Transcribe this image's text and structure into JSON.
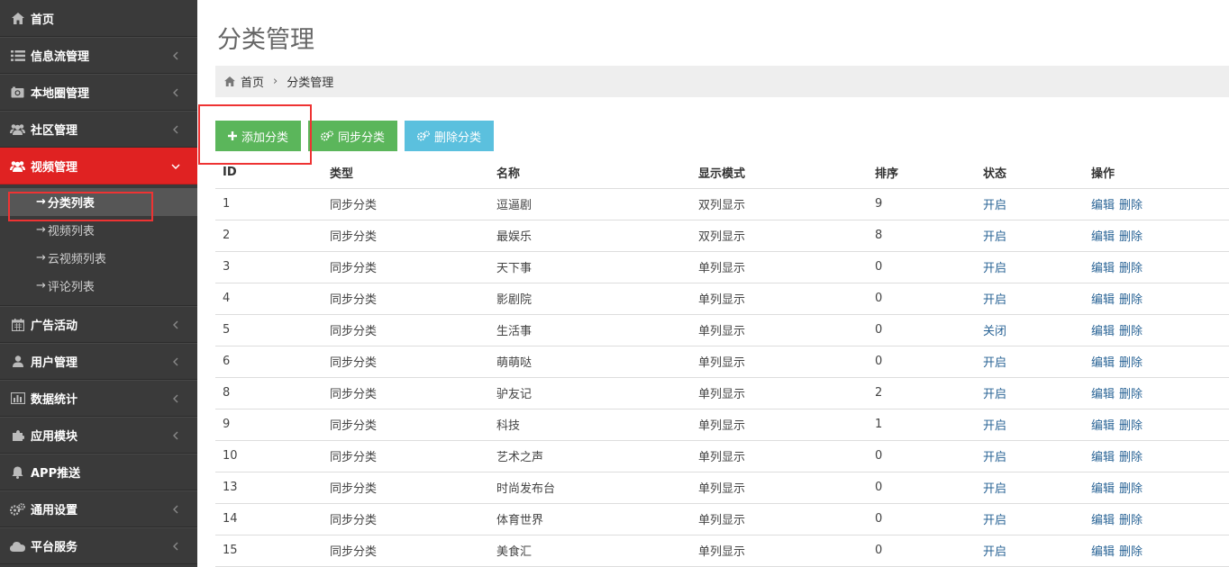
{
  "sidebar": {
    "items": [
      {
        "label": "首页",
        "icon": "home-icon"
      },
      {
        "label": "信息流管理",
        "icon": "list-icon"
      },
      {
        "label": "本地圈管理",
        "icon": "camera-icon"
      },
      {
        "label": "社区管理",
        "icon": "users-icon"
      },
      {
        "label": "视频管理",
        "icon": "users-icon"
      },
      {
        "label": "广告活动",
        "icon": "calendar-icon"
      },
      {
        "label": "用户管理",
        "icon": "user-icon"
      },
      {
        "label": "数据统计",
        "icon": "bar-chart-icon"
      },
      {
        "label": "应用模块",
        "icon": "puzzle-icon"
      },
      {
        "label": "APP推送",
        "icon": "bell-icon"
      },
      {
        "label": "通用设置",
        "icon": "gears-icon"
      },
      {
        "label": "平台服务",
        "icon": "cloud-icon"
      }
    ],
    "submenu": [
      "分类列表",
      "视频列表",
      "云视频列表",
      "评论列表"
    ],
    "active_color": "#e02222"
  },
  "page": {
    "title": "分类管理",
    "breadcrumb": {
      "home": "首页",
      "current": "分类管理"
    }
  },
  "toolbar": {
    "add_label": "添加分类",
    "sync_label": "同步分类",
    "delete_label": "删除分类"
  },
  "table": {
    "headers": [
      "ID",
      "类型",
      "名称",
      "显示模式",
      "排序",
      "状态",
      "操作"
    ],
    "edit_label": "编辑",
    "delete_label": "删除",
    "rows": [
      {
        "id": "1",
        "type": "同步分类",
        "name": "逗逼剧",
        "mode": "双列显示",
        "sort": "9",
        "status": "开启"
      },
      {
        "id": "2",
        "type": "同步分类",
        "name": "最娱乐",
        "mode": "双列显示",
        "sort": "8",
        "status": "开启"
      },
      {
        "id": "3",
        "type": "同步分类",
        "name": "天下事",
        "mode": "单列显示",
        "sort": "0",
        "status": "开启"
      },
      {
        "id": "4",
        "type": "同步分类",
        "name": "影剧院",
        "mode": "单列显示",
        "sort": "0",
        "status": "开启"
      },
      {
        "id": "5",
        "type": "同步分类",
        "name": "生活事",
        "mode": "单列显示",
        "sort": "0",
        "status": "关闭"
      },
      {
        "id": "6",
        "type": "同步分类",
        "name": "萌萌哒",
        "mode": "单列显示",
        "sort": "0",
        "status": "开启"
      },
      {
        "id": "8",
        "type": "同步分类",
        "name": "驴友记",
        "mode": "单列显示",
        "sort": "2",
        "status": "开启"
      },
      {
        "id": "9",
        "type": "同步分类",
        "name": "科技",
        "mode": "单列显示",
        "sort": "1",
        "status": "开启"
      },
      {
        "id": "10",
        "type": "同步分类",
        "name": "艺术之声",
        "mode": "单列显示",
        "sort": "0",
        "status": "开启"
      },
      {
        "id": "13",
        "type": "同步分类",
        "name": "时尚发布台",
        "mode": "单列显示",
        "sort": "0",
        "status": "开启"
      },
      {
        "id": "14",
        "type": "同步分类",
        "name": "体育世界",
        "mode": "单列显示",
        "sort": "0",
        "status": "开启"
      },
      {
        "id": "15",
        "type": "同步分类",
        "name": "美食汇",
        "mode": "单列显示",
        "sort": "0",
        "status": "开启"
      }
    ]
  }
}
